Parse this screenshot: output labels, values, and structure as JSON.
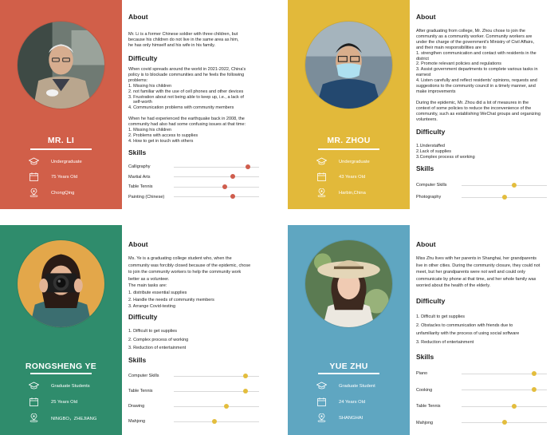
{
  "colors": {
    "red": "#d15f49",
    "yellow": "#e2b93a",
    "green": "#2f8c6c",
    "blue": "#5fa6c1",
    "dot_red": "#cf5d4d",
    "dot_yellow": "#e3bd3d"
  },
  "cards": [
    {
      "name": "MR. LI",
      "info": {
        "education": "Undergraduate",
        "age": "75 Years Old",
        "location": "ChongQing"
      },
      "about_heading": "About",
      "about": [
        "Mr. Li is a former Chinese soldier with three children, but",
        "because his children do not live in the same area as him,",
        "he has only himself and his wife in his family."
      ],
      "difficulty_heading": "Difficulty",
      "difficulty": [
        "When covid spreads around the world in 2021-2022, China's",
        "policy is to blockade communities and he feels the following",
        "problems:",
        "1. Missing his children",
        "2. not familiar with the use of cell phones and other devices",
        "3. Frustration about not being able to keep up, i.e., a lack of",
        "   self-worth",
        "4. Communication problems with community members",
        "",
        "When he had experienced the earthquake back in 2008, the",
        "community had also had some confusing issues at that time:",
        "1. Missing his children",
        "2. Problems with access to supplies",
        "4. How to get in touch with others"
      ],
      "skills_heading": "Skills",
      "skills": [
        {
          "label": "Calligraphy",
          "level": 0.87
        },
        {
          "label": "Martial Arts",
          "level": 0.69
        },
        {
          "label": "Table Tennis",
          "level": 0.6
        },
        {
          "label": "Painting (Chinese)",
          "level": 0.69
        }
      ]
    },
    {
      "name": "MR. ZHOU",
      "info": {
        "education": "Undergraduate",
        "age": "43 Years Old",
        "location": "Harbin,China"
      },
      "about_heading": "About",
      "about": [
        "After graduating from college, Mr. Zhou chose to join the",
        "community as a community worker. Community workers are",
        "under the charge of the government's Ministry of Civil Affairs,",
        "and their main responsibilities are to",
        "1. strengthen communication and contact with residents in the",
        "district",
        "2. Promote relevant policies and regulations",
        "3. Assist government departments to complete various tasks in",
        "earnest",
        "4. Listen carefully and reflect residents' opinions, requests and",
        "suggestions to the community council in a timely manner, and",
        "make improvements",
        "",
        "During the epidemic, Mr. Zhou did a lot of measures in the",
        "context of some policies to reduce the inconvenience of the",
        "community, such as establishing WeChat groups and organizing",
        "volunteers."
      ],
      "difficulty_heading": "Difficulty",
      "difficulty": [
        "1.Understaffed",
        "2.Lack of supplies",
        "3.Complex process of working"
      ],
      "skills_heading": "Skills",
      "skills": [
        {
          "label": "Computer Skills",
          "level": 0.62
        },
        {
          "label": "Photography",
          "level": 0.5
        }
      ]
    },
    {
      "name": "RONGSHENG YE",
      "info": {
        "education": "Graduate Students",
        "age": "25 Years Old",
        "location": "NINGBO，ZHEJIANG"
      },
      "about_heading": "About",
      "about": [
        "Ms. Ye is a graduating college student who, when the",
        "community was forcibly closed because of the epidemic, chose",
        "to join the community workers to help the community work",
        "better as a volunteer.",
        "The main tasks are:",
        "1. distribute essential supplies",
        "2. Handle the needs of community members",
        "3. Arrange Covid-testing"
      ],
      "difficulty_heading": "Difficulty",
      "difficulty": [
        "1. Difficult to get supplies",
        "2. Complex process of working",
        "3. Reduction of entertainment"
      ],
      "skills_heading": "Skills",
      "skills": [
        {
          "label": "Computer Skills",
          "level": 0.84
        },
        {
          "label": "Table Tennis",
          "level": 0.84
        },
        {
          "label": "Drawing",
          "level": 0.62
        },
        {
          "label": "Mahjong",
          "level": 0.48
        }
      ]
    },
    {
      "name": "YUE ZHU",
      "info": {
        "education": "Graduate Student",
        "age": "24 Years Old",
        "location": "SHANGHAI"
      },
      "about_heading": "About",
      "about": [
        "Miss Zhu lives with her parents in Shanghai, her grandparents",
        "live in other cities. During the community closure, they could not",
        "meet, but her grandparents were not well and could only",
        "communicate by phone at that time, and her whole family was",
        "worried about the health of the elderly."
      ],
      "difficulty_heading": "Difficulty",
      "difficulty": [
        "1. Difficult to get supplies",
        "2. Obstacles to communication with friends due to",
        "unfamiliarity with the process of using social software",
        "3. Reduction of entertainment"
      ],
      "skills_heading": "Skills",
      "skills": [
        {
          "label": "Piano",
          "level": 0.85
        },
        {
          "label": "Cooking",
          "level": 0.85
        },
        {
          "label": "Table Tennis",
          "level": 0.62
        },
        {
          "label": "Mahjong",
          "level": 0.5
        }
      ]
    }
  ]
}
